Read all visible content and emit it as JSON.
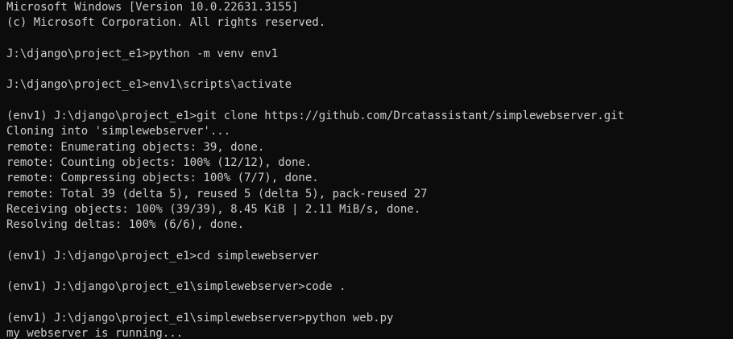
{
  "colors": {
    "background": "#0c0c0c",
    "foreground": "#cccccc"
  },
  "terminal": {
    "lines": [
      "Microsoft Windows [Version 10.0.22631.3155]",
      "(c) Microsoft Corporation. All rights reserved.",
      "",
      "J:\\django\\project_e1>python -m venv env1",
      "",
      "J:\\django\\project_e1>env1\\scripts\\activate",
      "",
      "(env1) J:\\django\\project_e1>git clone https://github.com/Drcatassistant/simplewebserver.git",
      "Cloning into 'simplewebserver'...",
      "remote: Enumerating objects: 39, done.",
      "remote: Counting objects: 100% (12/12), done.",
      "remote: Compressing objects: 100% (7/7), done.",
      "remote: Total 39 (delta 5), reused 5 (delta 5), pack-reused 27",
      "Receiving objects: 100% (39/39), 8.45 KiB | 2.11 MiB/s, done.",
      "Resolving deltas: 100% (6/6), done.",
      "",
      "(env1) J:\\django\\project_e1>cd simplewebserver",
      "",
      "(env1) J:\\django\\project_e1\\simplewebserver>code .",
      "",
      "(env1) J:\\django\\project_e1\\simplewebserver>python web.py",
      "my webserver is running..."
    ]
  }
}
